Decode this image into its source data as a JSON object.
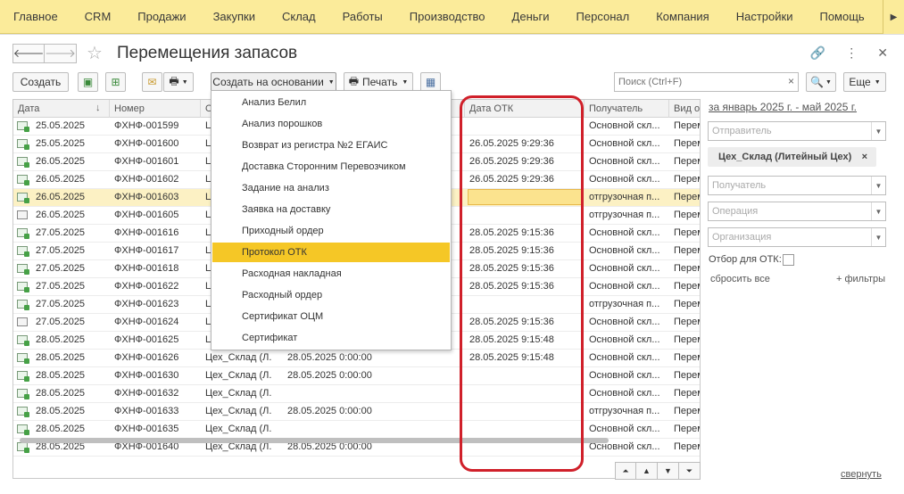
{
  "topmenu": {
    "items": [
      "Главное",
      "CRM",
      "Продажи",
      "Закупки",
      "Склад",
      "Работы",
      "Производство",
      "Деньги",
      "Персонал",
      "Компания",
      "Настройки",
      "Помощь"
    ],
    "more_icon": "chevron-right-icon"
  },
  "window": {
    "title": "Перемещения запасов",
    "back_icon": "arrow-left-icon",
    "forward_icon": "arrow-right-icon",
    "favorite_icon": "star-icon",
    "link_icon": "link-icon",
    "menu_icon": "more-vertical-icon",
    "close_icon": "close-icon"
  },
  "toolbar": {
    "create_label": "Создать",
    "based_on_label": "Создать на основании",
    "print_label": "Печать",
    "more_label": "Еще",
    "search_placeholder": "Поиск (Ctrl+F)",
    "search_clear": "×"
  },
  "dropdown": {
    "items": [
      "Анализ Белил",
      "Анализ порошков",
      "Возврат из регистра №2 ЕГАИС",
      "Доставка Сторонним Перевозчиком",
      "Задание на анализ",
      "Заявка на доставку",
      "Приходный ордер",
      "Протокол ОТК",
      "Расходная накладная",
      "Расходный ордер",
      "Сертификат ОЦМ",
      "Сертификат"
    ],
    "active": "Протокол ОТК"
  },
  "table": {
    "columns": {
      "date": "Дата",
      "number": "Номер",
      "sender": "О",
      "otk_date": "Дата ОТК",
      "recipient": "Получатель",
      "op_type": "Вид оп"
    },
    "rows": [
      {
        "date": "25.05.2025",
        "number": "ФХНФ-001599",
        "sender": "Ц",
        "doc_date": "",
        "otk": "",
        "recipient": "Основной скл...",
        "op": "Перем",
        "icon": "posted"
      },
      {
        "date": "25.05.2025",
        "number": "ФХНФ-001600",
        "sender": "Ц",
        "doc_date": "",
        "otk": "26.05.2025 9:29:36",
        "recipient": "Основной скл...",
        "op": "Перем",
        "icon": "posted"
      },
      {
        "date": "26.05.2025",
        "number": "ФХНФ-001601",
        "sender": "Ц",
        "doc_date": "",
        "otk": "26.05.2025 9:29:36",
        "recipient": "Основной скл...",
        "op": "Перем",
        "icon": "posted"
      },
      {
        "date": "26.05.2025",
        "number": "ФХНФ-001602",
        "sender": "Ц",
        "doc_date": "",
        "otk": "26.05.2025 9:29:36",
        "recipient": "Основной скл...",
        "op": "Перем",
        "icon": "posted"
      },
      {
        "date": "26.05.2025",
        "number": "ФХНФ-001603",
        "sender": "Ц",
        "doc_date": "",
        "otk": "",
        "recipient": "отгрузочная п...",
        "op": "Перем",
        "icon": "posted",
        "selected": true
      },
      {
        "date": "26.05.2025",
        "number": "ФХНФ-001605",
        "sender": "Ц",
        "doc_date": "",
        "otk": "",
        "recipient": "отгрузочная п...",
        "op": "Перем",
        "icon": "draft"
      },
      {
        "date": "27.05.2025",
        "number": "ФХНФ-001616",
        "sender": "Ц",
        "doc_date": "",
        "otk": "28.05.2025 9:15:36",
        "recipient": "Основной скл...",
        "op": "Перем",
        "icon": "posted"
      },
      {
        "date": "27.05.2025",
        "number": "ФХНФ-001617",
        "sender": "Ц",
        "doc_date": "",
        "otk": "28.05.2025 9:15:36",
        "recipient": "Основной скл...",
        "op": "Перем",
        "icon": "posted"
      },
      {
        "date": "27.05.2025",
        "number": "ФХНФ-001618",
        "sender": "Ц",
        "doc_date": "",
        "otk": "28.05.2025 9:15:36",
        "recipient": "Основной скл...",
        "op": "Перем",
        "icon": "posted"
      },
      {
        "date": "27.05.2025",
        "number": "ФХНФ-001622",
        "sender": "Ц",
        "doc_date": "",
        "otk": "28.05.2025 9:15:36",
        "recipient": "Основной скл...",
        "op": "Перем",
        "icon": "posted"
      },
      {
        "date": "27.05.2025",
        "number": "ФХНФ-001623",
        "sender": "Ц",
        "doc_date": "",
        "otk": "",
        "recipient": "отгрузочная п...",
        "op": "Перем",
        "icon": "posted"
      },
      {
        "date": "27.05.2025",
        "number": "ФХНФ-001624",
        "sender": "Ц",
        "doc_date": "",
        "otk": "28.05.2025 9:15:36",
        "recipient": "Основной скл...",
        "op": "Перем",
        "icon": "draft"
      },
      {
        "date": "28.05.2025",
        "number": "ФХНФ-001625",
        "sender": "Ц",
        "doc_date": "",
        "otk": "28.05.2025 9:15:48",
        "recipient": "Основной скл...",
        "op": "Перем",
        "icon": "posted"
      },
      {
        "date": "28.05.2025",
        "number": "ФХНФ-001626",
        "sender": "Цех_Склад (Л...",
        "doc_date": "28.05.2025 0:00:00",
        "otk": "28.05.2025 9:15:48",
        "recipient": "Основной скл...",
        "op": "Перем",
        "icon": "posted"
      },
      {
        "date": "28.05.2025",
        "number": "ФХНФ-001630",
        "sender": "Цех_Склад (Л...",
        "doc_date": "28.05.2025 0:00:00",
        "otk": "",
        "recipient": "Основной скл...",
        "op": "Перем",
        "icon": "posted"
      },
      {
        "date": "28.05.2025",
        "number": "ФХНФ-001632",
        "sender": "Цех_Склад (Л...",
        "doc_date": "",
        "otk": "",
        "recipient": "Основной скл...",
        "op": "Перем",
        "icon": "posted"
      },
      {
        "date": "28.05.2025",
        "number": "ФХНФ-001633",
        "sender": "Цех_Склад (Л...",
        "doc_date": "28.05.2025 0:00:00",
        "otk": "",
        "recipient": "отгрузочная п...",
        "op": "Перем",
        "icon": "posted"
      },
      {
        "date": "28.05.2025",
        "number": "ФХНФ-001635",
        "sender": "Цех_Склад (Л...",
        "doc_date": "",
        "otk": "",
        "recipient": "Основной скл...",
        "op": "Перем",
        "icon": "posted"
      },
      {
        "date": "28.05.2025",
        "number": "ФХНФ-001640",
        "sender": "Цех_Склад (Л...",
        "doc_date": "28.05.2025 0:00:00",
        "otk": "",
        "recipient": "Основной скл...",
        "op": "Перем",
        "icon": "posted"
      }
    ]
  },
  "filters": {
    "period": "за январь 2025 г. - май 2025 г.",
    "sender_placeholder": "Отправитель",
    "sender_chip": "Цех_Склад (Литейный Цех)",
    "chip_remove": "×",
    "recipient_placeholder": "Получатель",
    "operation_placeholder": "Операция",
    "organization_placeholder": "Организация",
    "otk_filter_label": "Отбор для ОТК:",
    "reset_label": "сбросить все",
    "more_filters_label": "+ фильтры",
    "collapse_label": "свернуть"
  },
  "colors": {
    "menu_bg": "#fbeb9a",
    "accent_yellow": "#f5c726",
    "highlight_red": "#d0202a",
    "selected_row": "#fcf1c4"
  }
}
